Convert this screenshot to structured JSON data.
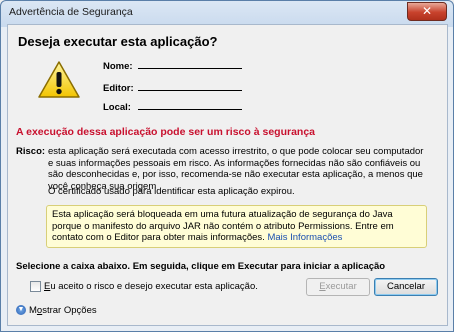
{
  "window": {
    "title": "Advertência de Segurança",
    "close_glyph": "✕"
  },
  "header": {
    "question": "Deseja executar esta aplicação?"
  },
  "icons": {
    "warning": "warning-triangle-icon"
  },
  "fields": {
    "name_label": "Nome:",
    "publisher_label": "Editor:",
    "location_label": "Local:"
  },
  "risk": {
    "heading": "A execução dessa aplicação pode ser um risco à segurança",
    "label": "Risco:",
    "text": "esta aplicação será executada com acesso irrestrito, o que pode colocar seu computador e suas informações pessoais em risco. As informações fornecidas não são confiáveis ou são desconhecidas e, por isso, recomenda-se não executar esta aplicação, a menos que você conheça sua origem",
    "cert_text": "O certificado usado para identificar esta aplicação expirou."
  },
  "notice": {
    "text": "Esta aplicação será bloqueada em uma futura atualização de segurança do Java porque o manifesto do arquivo JAR não contém o atributo Permissions. Entre em contato com o Editor para obter mais informações. ",
    "link": "Mais Informações"
  },
  "actions": {
    "instruction": "Selecione a caixa abaixo. Em seguida, clique em Executar para iniciar a aplicação",
    "accept_checkbox_label": "Eu aceito o risco e desejo executar esta aplicação.",
    "accept_checked": false,
    "run_button": "Executar",
    "cancel_button": "Cancelar",
    "show_options": "Mostrar Opções"
  },
  "colors": {
    "risk_heading": "#c8102e",
    "notice_bg": "#fffdd6",
    "link": "#1a4fb0"
  }
}
